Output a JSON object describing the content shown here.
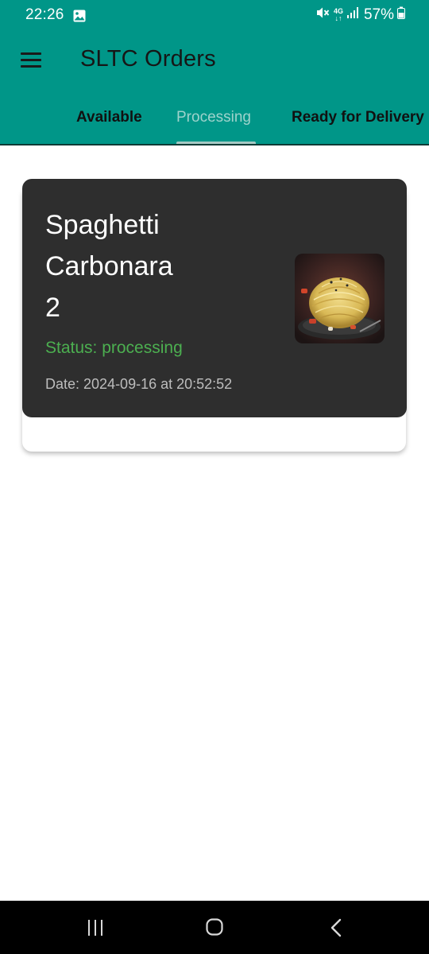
{
  "status_bar": {
    "time": "22:26",
    "network_top": "4G",
    "network_bottom": "↓↑",
    "battery": "57%",
    "icons": [
      "gallery-icon",
      "mute-icon",
      "signal-icon",
      "battery-icon"
    ]
  },
  "app_bar": {
    "title": "SLTC Orders",
    "menu_icon": "hamburger-menu-icon",
    "color": "#009688"
  },
  "tabs": [
    {
      "label": "Available",
      "selected": false
    },
    {
      "label": "Processing",
      "selected": true
    },
    {
      "label": "Ready for Delivery",
      "selected": false
    }
  ],
  "orders": [
    {
      "name": "Spaghetti Carbonara",
      "quantity": "2",
      "status": "Status: processing",
      "date": "Date: 2024-09-16 at 20:52:52",
      "image": "spaghetti-image",
      "status_color": "#4caf50"
    }
  ],
  "nav_bar": {
    "icons": [
      "recents-icon",
      "home-icon",
      "back-icon"
    ]
  }
}
